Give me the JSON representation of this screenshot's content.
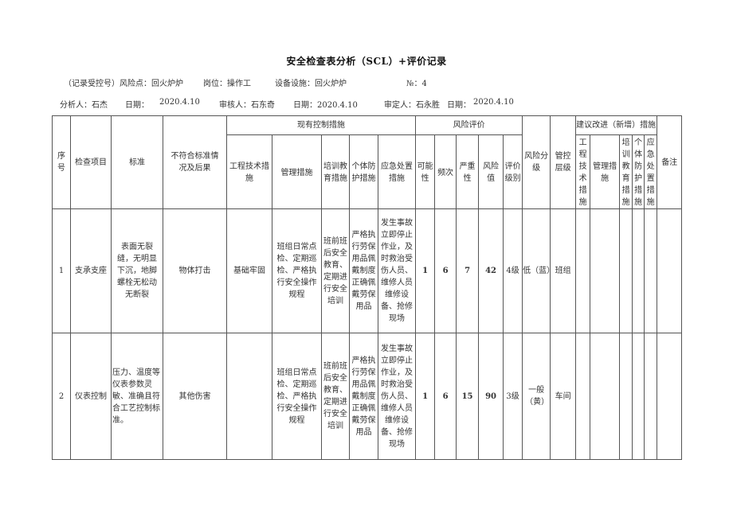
{
  "document": {
    "title": "安全检查表分析（SCL）+评价记录",
    "info_line1": {
      "record_no_label": "（记录受控号）风险点：回火炉炉",
      "post": "岗位：操作工",
      "equipment": "设备设施：回火炉炉",
      "number": "№：4"
    },
    "info_line2": {
      "analyst": "分析人：石杰",
      "analyst_date_label": "日期：",
      "analyst_date": "2020.4.10",
      "reviewer": "审核人：石东奇",
      "reviewer_date": "日期：2020.4.10",
      "approver": "审定人：石永胜",
      "approver_date_label": "日期：",
      "approver_date": "2020.4.10"
    }
  },
  "table": {
    "headers": {
      "seq": "序号",
      "item": "检查项目",
      "standard": "标准",
      "nonconform": "不符合标准情况及后果",
      "existing_group": "现有控制措施",
      "eng": "工程技术措施",
      "mgmt": "管理措施",
      "training": "培训教育措施",
      "ppe": "个体防护措施",
      "emergency": "应急处置措施",
      "risk_group": "风险评价",
      "likelihood": "可能性",
      "frequency": "频次",
      "severity": "严重性",
      "risk_value": "风险值",
      "eval_level": "评价级别",
      "risk_grade": "风险分级",
      "control_level": "管控层级",
      "suggest_group": "建议改进（新增）措施",
      "s_eng": "工程技术措施",
      "s_mgmt": "管理措施",
      "s_training": "培训教育措施",
      "s_ppe": "个体防护措施",
      "s_emergency": "应急处置措施",
      "remark": "备注"
    },
    "rows": [
      {
        "seq": "1",
        "item": "支承支座",
        "standard": "表面无裂缝，无明显下沉，地脚螺栓无松动无断裂",
        "nonconform": "物体打击",
        "eng": "基础牢固",
        "mgmt": "班组日常点检、定期巡检、严格执行安全操作规程",
        "training": "班前班后安全教育、定期进行安全培训",
        "ppe": "严格执行劳保用品佩戴制度正确佩戴劳保用品",
        "emergency": "发生事故立即停止作业，及时救治受伤人员、维修人员维修设备、抢修现场",
        "likelihood": "1",
        "frequency": "6",
        "severity": "7",
        "risk_value": "42",
        "eval_level": "4级",
        "risk_grade": "低（蓝）",
        "control_level": "班组",
        "s_eng": "",
        "s_mgmt": "",
        "s_training": "",
        "s_ppe": "",
        "s_emergency": "",
        "remark": ""
      },
      {
        "seq": "2",
        "item": "仪表控制",
        "standard": "压力、温度等仪表参数灵敏、准确且符合工艺控制标准。",
        "nonconform": "其他伤害",
        "eng": "",
        "mgmt": "班组日常点检、定期巡检、严格执行安全操作规程",
        "training": "班前班后安全教育、定期进行安全培训",
        "ppe": "严格执行劳保用品佩戴制度正确佩戴劳保用品",
        "emergency": "发生事故立即停止作业，及时救治受伤人员、维修人员维修设备、抢修现场",
        "likelihood": "1",
        "frequency": "6",
        "severity": "15",
        "risk_value": "90",
        "eval_level": "3级",
        "risk_grade": "一般（黄）",
        "control_level": "车间",
        "s_eng": "",
        "s_mgmt": "",
        "s_training": "",
        "s_ppe": "",
        "s_emergency": "",
        "remark": ""
      }
    ]
  }
}
